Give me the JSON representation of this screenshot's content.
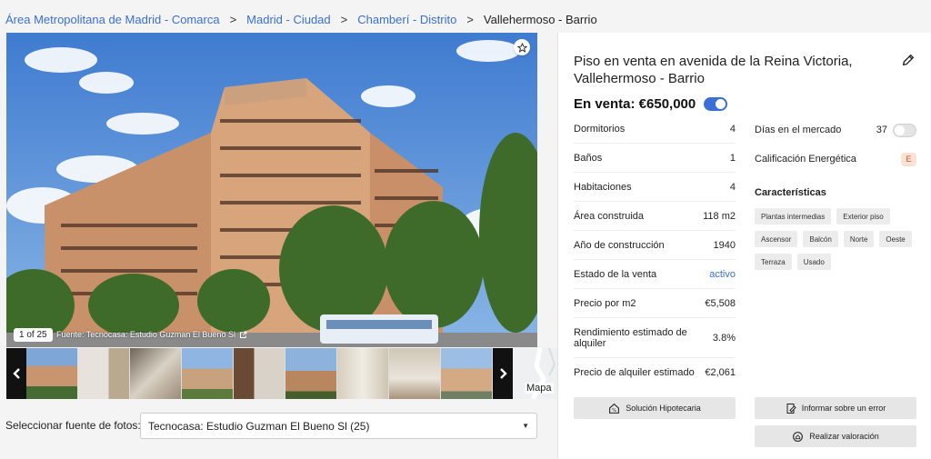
{
  "breadcrumb": {
    "items": [
      "Área Metropolitana de Madrid - Comarca",
      "Madrid - Ciudad",
      "Chamberí - Distrito"
    ],
    "separator": ">",
    "current": "Vallehermoso - Barrio"
  },
  "photo": {
    "counter": "1 of 25",
    "source": "Fuente: Tecnocasa: Estudio Guzman El Bueno Sl",
    "watermark": "TECNOCASA"
  },
  "thumbnails": {
    "count": 9,
    "map_label": "Mapa"
  },
  "photo_source": {
    "label": "Seleccionar fuente de fotos:",
    "value": "Tecnocasa: Estudio Guzman El Bueno Sl (25)"
  },
  "listing": {
    "title": "Piso en venta en avenida de la Reina Victoria, Vallehermoso - Barrio",
    "price": "En venta: €650,000",
    "facts": [
      {
        "label": "Dormitorios",
        "value": "4"
      },
      {
        "label": "Baños",
        "value": "1"
      },
      {
        "label": "Habitaciones",
        "value": "4"
      },
      {
        "label": "Área construida",
        "value": "118 m2"
      },
      {
        "label": "Año de construcción",
        "value": "1940"
      },
      {
        "label": "Estado de la venta",
        "value": "activo"
      },
      {
        "label": "Precio por m2",
        "value": "€5,508"
      },
      {
        "label": "Rendimiento estimado de alquiler",
        "value": "3.8%"
      },
      {
        "label": "Precio de alquiler estimado",
        "value": "€2,061"
      }
    ],
    "days_label": "Días en el mercado",
    "days_value": "37",
    "energy_label": "Calificación Energética",
    "energy_value": "E",
    "features_title": "Características",
    "features": [
      "Plantas intermedias",
      "Exterior piso",
      "Ascensor",
      "Balcón",
      "Norte",
      "Oeste",
      "Terraza",
      "Usado"
    ],
    "actions": {
      "mortgage": "Solución Hipotecaria",
      "report": "Informar sobre un error",
      "valuation": "Realizar valoración"
    }
  },
  "colors": {
    "accent": "#3a6fd6",
    "energy_badge_bg": "#fde3d6",
    "energy_badge_text": "#c4532a"
  }
}
